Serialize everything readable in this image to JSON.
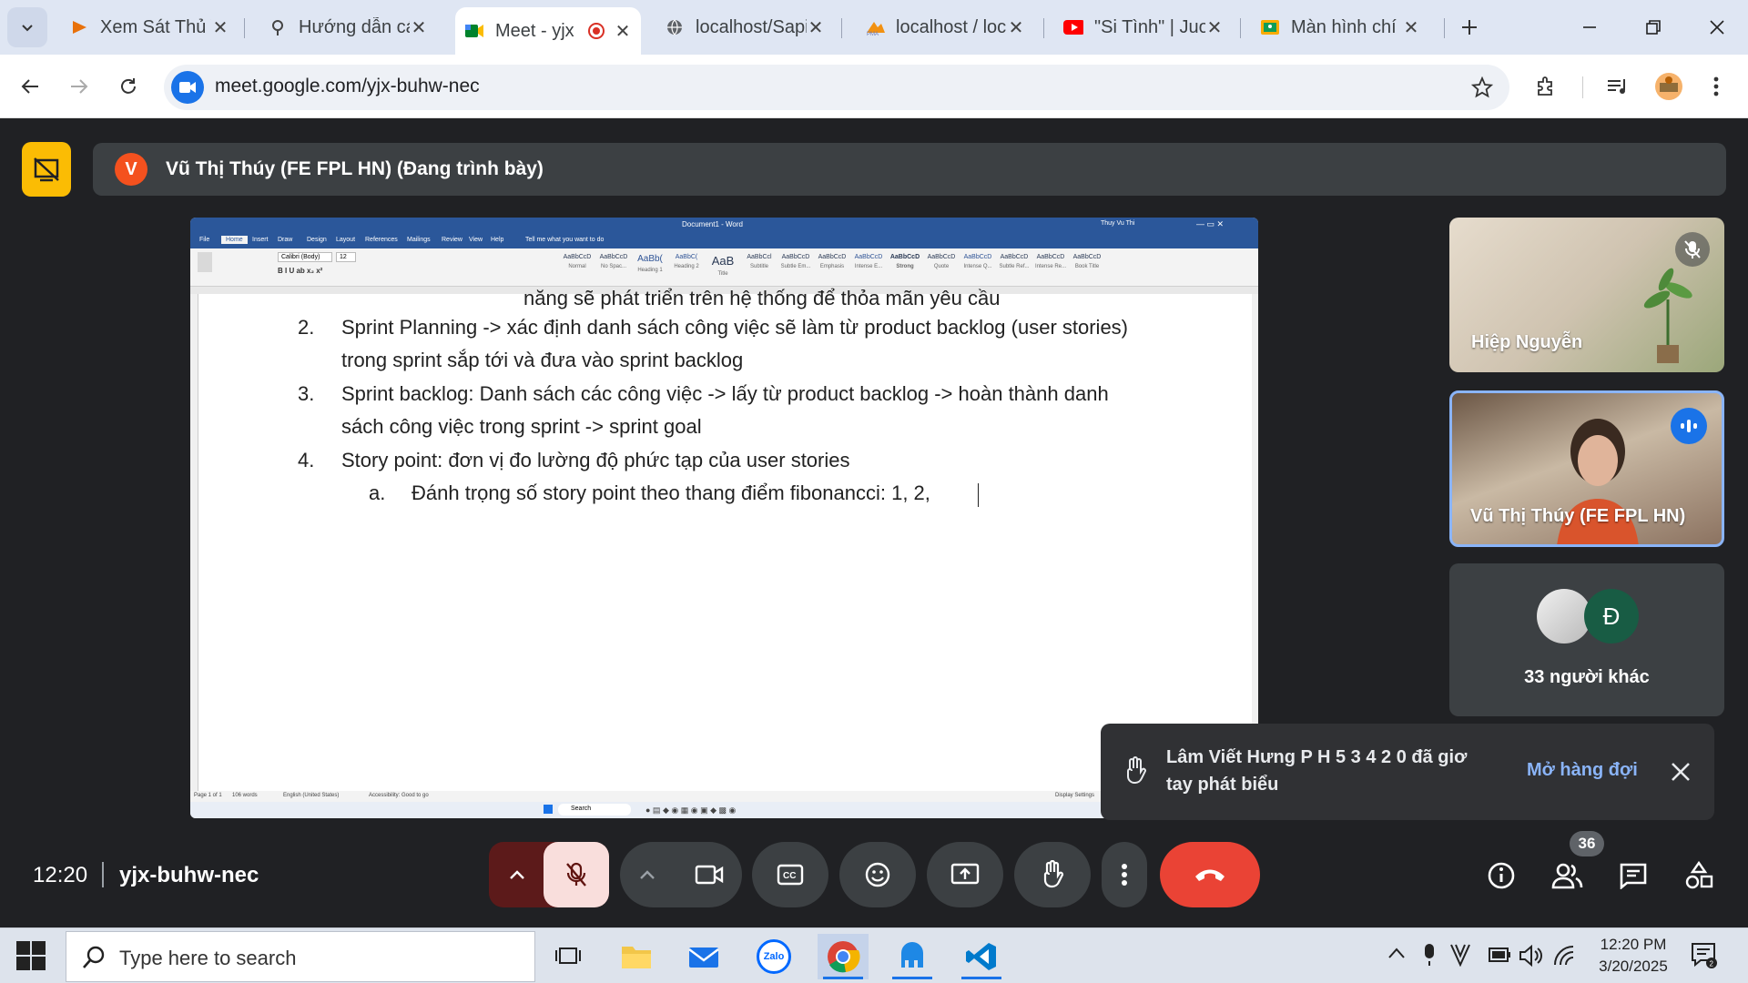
{
  "browser": {
    "tabs": [
      {
        "title": "Xem Sát Thủ \\",
        "icon": "video-play-icon",
        "color": "#e8710a"
      },
      {
        "title": "Hướng dẫn cá",
        "icon": "pin-icon",
        "color": "#444"
      },
      {
        "title": "Meet - yjx",
        "icon": "meet-icon",
        "color": "#00832d",
        "active": true,
        "recording": true
      },
      {
        "title": "localhost/Sapi",
        "icon": "globe-icon",
        "color": "#5f6368"
      },
      {
        "title": "localhost / loc",
        "icon": "phpmyadmin-icon",
        "color": "#f29111"
      },
      {
        "title": "\"Si Tình\" | Juo",
        "icon": "youtube-icon",
        "color": "#ff0000"
      },
      {
        "title": "Màn hình chí",
        "icon": "classroom-icon",
        "color": "#f9ab00"
      }
    ],
    "url": "meet.google.com/yjx-buhw-nec"
  },
  "meet": {
    "presenter_initial": "V",
    "presenter_banner": "Vũ Thị Thúy (FE FPL HN) (Đang trình bày)",
    "participants": [
      {
        "name": "Hiệp Nguyễn",
        "muted": true
      },
      {
        "name": "Vũ Thị Thúy (FE FPL HN)",
        "speaking": true
      },
      {
        "others_label": "33 người khác",
        "avatar_letter": "Đ"
      }
    ],
    "toast": {
      "text": "Lâm Viết Hưng P H 5 3 4 2 0 đã giơ tay phát biểu",
      "action": "Mở hàng đợi"
    },
    "time": "12:20",
    "code": "yjx-buhw-nec",
    "participant_count": "36"
  },
  "word": {
    "window_title": "Document1 - Word",
    "user": "Thuy Vu Thi",
    "tabs": [
      "File",
      "Home",
      "Insert",
      "Draw",
      "Design",
      "Layout",
      "References",
      "Mailings",
      "Review",
      "View",
      "Help"
    ],
    "tell_me": "Tell me what you want to do",
    "font": "Calibri (Body)",
    "size": "12",
    "styles": [
      "Normal",
      "No Spac...",
      "Heading 1",
      "Heading 2",
      "Title",
      "Subtitle",
      "Subtle Em...",
      "Emphasis",
      "Intense E...",
      "Strong",
      "Quote",
      "Intense Q...",
      "Subtle Ref...",
      "Intense Re...",
      "Book Title"
    ],
    "doc_lines": [
      {
        "num": "",
        "text": "năng sẽ phát triển trên hệ thống để thỏa mãn yêu cầu"
      },
      {
        "num": "2.",
        "text": "Sprint Planning -> xác định danh sách công việc sẽ làm từ product backlog (user stories)"
      },
      {
        "num": "",
        "text": "trong sprint sắp tới và đưa vào sprint backlog"
      },
      {
        "num": "3.",
        "text": "Sprint backlog: Danh sách các công việc -> lấy từ product backlog -> hoàn thành danh"
      },
      {
        "num": "",
        "text": "sách công việc trong sprint -> sprint goal"
      },
      {
        "num": "4.",
        "text": "Story point: đơn vị đo lường độ phức tạp của user stories"
      },
      {
        "num": "a.",
        "text": "Đánh trọng số story point theo thang điểm fibonancci: 1, 2,"
      }
    ],
    "status": {
      "page": "Page 1 of 1",
      "words": "106 words",
      "lang": "English (United States)",
      "access": "Accessibility: Good to go",
      "display": "Display Settings"
    },
    "inner_search": "Search"
  },
  "taskbar": {
    "search_placeholder": "Type here to search",
    "time": "12:20 PM",
    "date": "3/20/2025",
    "zalo_label": "Zalo"
  }
}
